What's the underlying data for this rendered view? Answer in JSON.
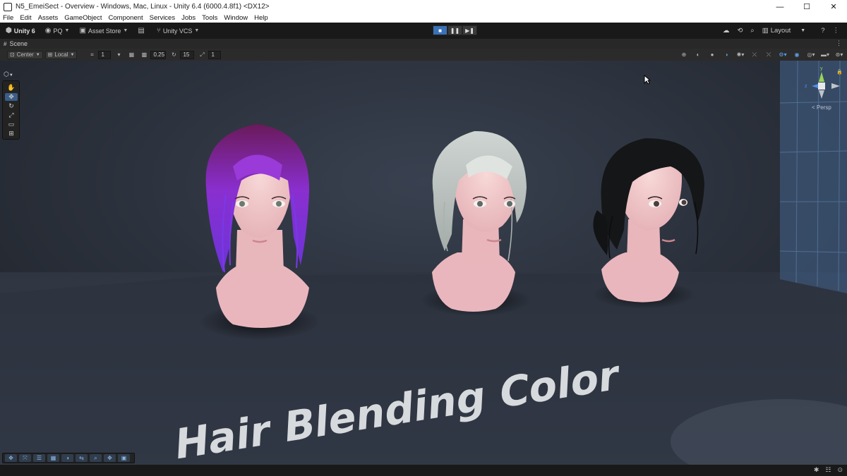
{
  "window": {
    "title": "N5_EmeiSect - Overview - Windows, Mac, Linux - Unity 6.4 (6000.4.8f1) <DX12>",
    "controls": {
      "minimize": "—",
      "maximize": "☐",
      "close": "✕"
    }
  },
  "menu": [
    "File",
    "Edit",
    "Assets",
    "GameObject",
    "Component",
    "Services",
    "Jobs",
    "Tools",
    "Window",
    "Help"
  ],
  "toolbar": {
    "unity_label": "Unity 6",
    "account_label": "PQ",
    "asset_store_label": "Asset Store",
    "vcs_label": "Unity VCS",
    "layout_label": "Layout"
  },
  "scene_tab": {
    "label": "Scene"
  },
  "scene_toolbar": {
    "pivot_label": "Center",
    "space_label": "Local",
    "grid_snap_value": "1",
    "increment_snap_value": "0.25",
    "rotate_snap_value": "15",
    "scale_snap_value": "1"
  },
  "gizmo": {
    "projection_label": "< Persp",
    "x_label": "x",
    "y_label": "y",
    "z_label": "z"
  },
  "scene": {
    "caption": "Hair Blending Color",
    "colors": {
      "background": "#2a2f38",
      "floor": "#2e3440",
      "purple_hair": "#8a2fd0",
      "silver_hair": "#b8c0bd",
      "black_hair": "#151618",
      "skin": "#f1c8cb"
    }
  }
}
